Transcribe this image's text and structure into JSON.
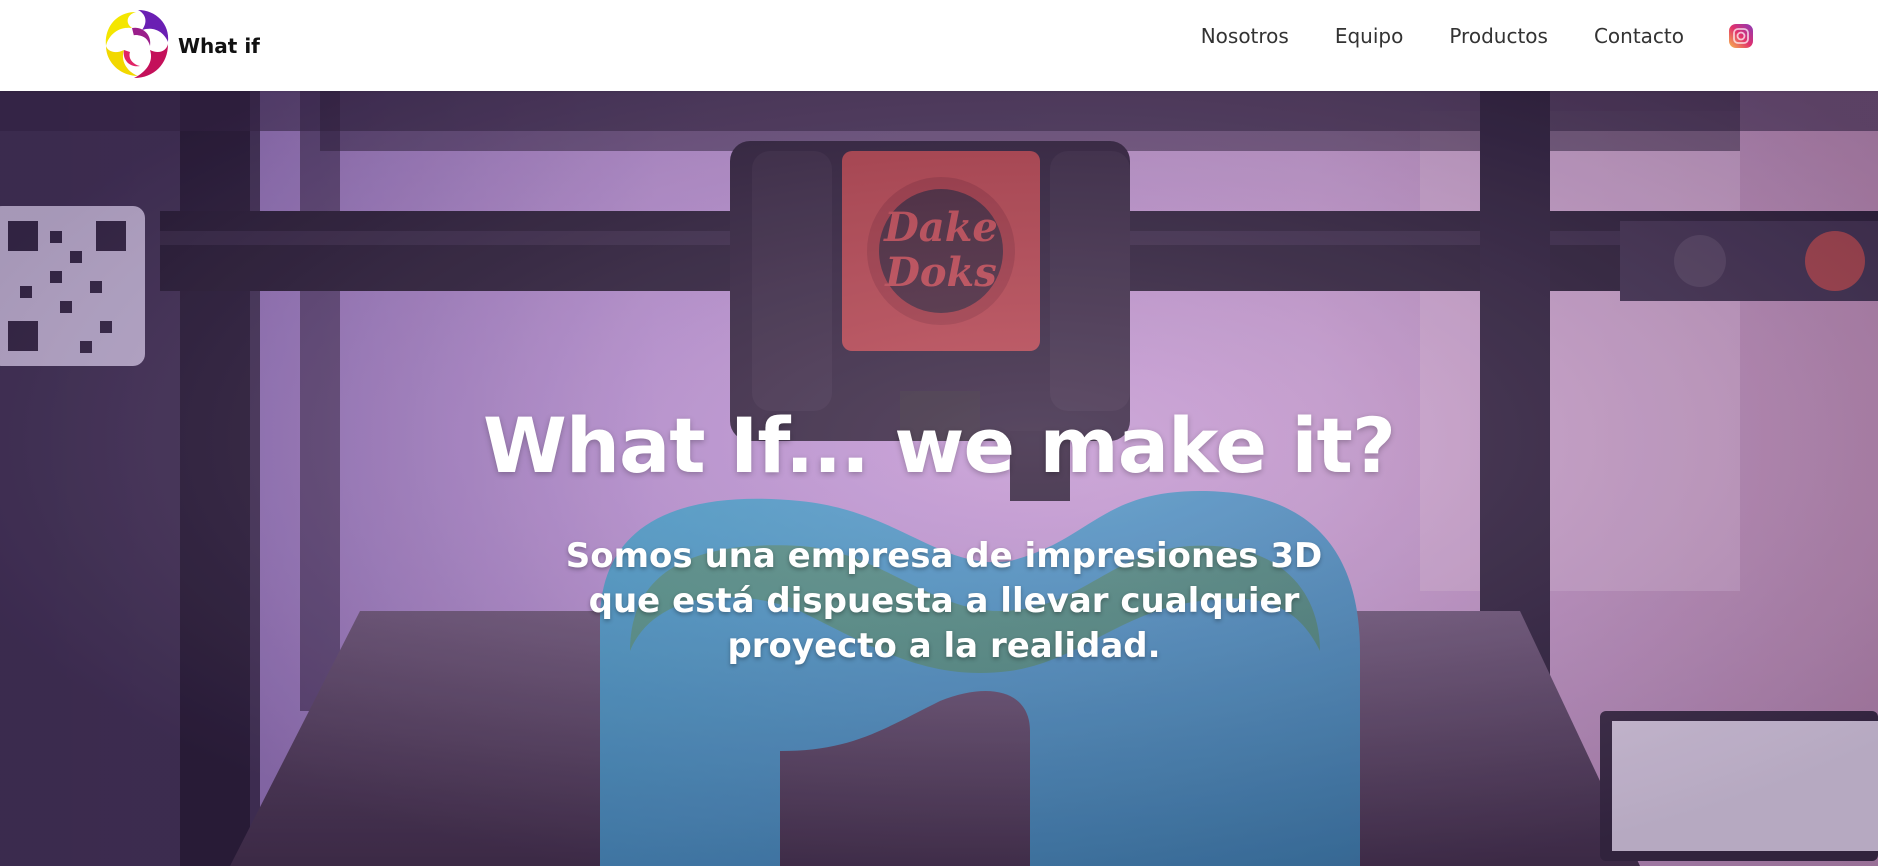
{
  "brand": {
    "name": "What if",
    "colors": {
      "yellow": "#f4e600",
      "purple": "#6a1fb3",
      "magenta": "#c4105a"
    }
  },
  "nav": {
    "items": [
      {
        "label": "Nosotros"
      },
      {
        "label": "Equipo"
      },
      {
        "label": "Productos"
      },
      {
        "label": "Contacto"
      }
    ],
    "social_icon": "instagram-icon"
  },
  "hero": {
    "title": "What If... we make it?",
    "subtitle": "Somos una empresa de impresiones 3D que está dispuesta a llevar cualquier proyecto a la realidad.",
    "background_image": "3d-printer-photo"
  }
}
